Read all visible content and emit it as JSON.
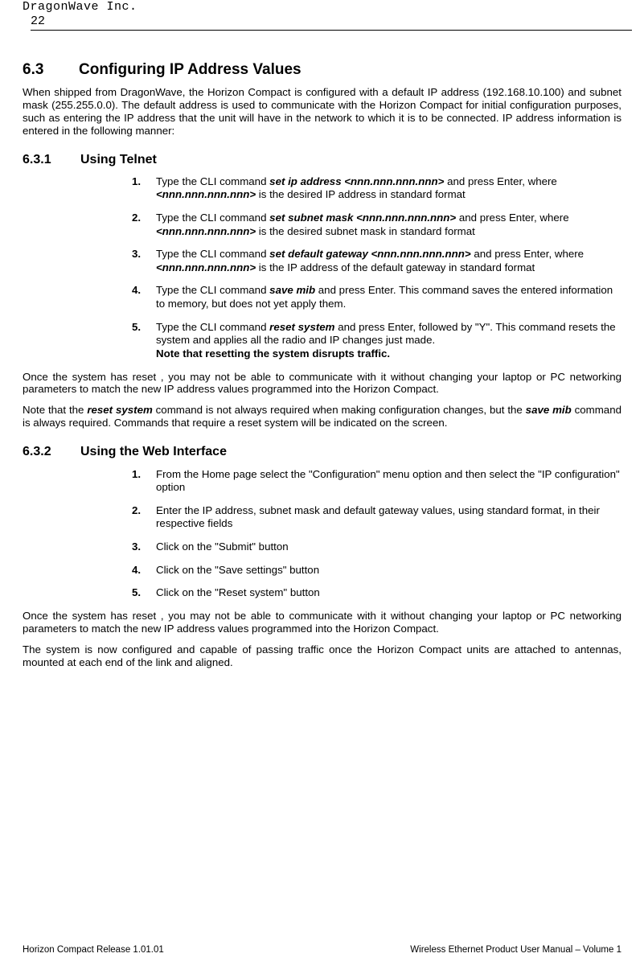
{
  "header": {
    "company": "DragonWave Inc.",
    "page_number": "22"
  },
  "s63": {
    "num": "6.3",
    "title": "Configuring IP Address Values",
    "intro": "When shipped from DragonWave, the Horizon Compact is configured with a default IP address (192.168.10.100) and subnet mask (255.255.0.0). The default address is used to communicate with the Horizon Compact for initial configuration purposes, such as entering the IP address that the unit will have in the network to which it is to be connected. IP address information is entered in the following manner:"
  },
  "s631": {
    "num": "6.3.1",
    "title": "Using Telnet",
    "items": [
      {
        "n": "1.",
        "pre": "Type the CLI command ",
        "cmd": "set ip address <nnn.nnn.nnn.nnn>",
        "mid": " and press Enter, where ",
        "arg": "<nnn.nnn.nnn.nnn>",
        "post": " is the desired IP address in standard format"
      },
      {
        "n": "2.",
        "pre": "Type the CLI command ",
        "cmd": "set subnet mask <nnn.nnn.nnn.nnn>",
        "mid": " and press Enter, where ",
        "arg": "<nnn.nnn.nnn.nnn>",
        "post": " is the desired subnet mask in standard format"
      },
      {
        "n": "3.",
        "pre": "Type the CLI command ",
        "cmd": "set default gateway <nnn.nnn.nnn.nnn>",
        "mid": " and press Enter, where ",
        "arg": "<nnn.nnn.nnn.nnn>",
        "post": " is the IP address of the default gateway in standard format"
      },
      {
        "n": "4.",
        "pre": "Type the CLI command ",
        "cmd": "save mib",
        "mid": " and press Enter. This command saves the entered information to memory, but does not yet apply them.",
        "arg": "",
        "post": ""
      },
      {
        "n": "5.",
        "pre": "Type the CLI command ",
        "cmd": "reset system",
        "mid": " and press Enter, followed by \"Y\". This command resets the system and applies all the radio and IP changes just made.",
        "arg": "",
        "post": "",
        "notebold": "Note that resetting the system disrupts traffic."
      }
    ],
    "after1": "Once the system has reset , you may not be able to communicate with it without changing your laptop or PC networking parameters to match the new IP address values programmed into the Horizon Compact.",
    "after2_pre": "Note that the ",
    "after2_cmd1": "reset system",
    "after2_mid1": " command is not always required when making configuration changes, but the ",
    "after2_cmd2": "save mib",
    "after2_post": " command is always required. Commands that require a reset system will be indicated on the screen."
  },
  "s632": {
    "num": "6.3.2",
    "title": "Using the Web Interface",
    "items": [
      {
        "n": "1.",
        "text": "From the Home page select the \"Configuration\" menu option and then select the \"IP configuration\" option"
      },
      {
        "n": "2.",
        "text": "Enter the IP address, subnet mask and default gateway values, using standard format, in their respective fields"
      },
      {
        "n": "3.",
        "text": "Click on the \"Submit\" button"
      },
      {
        "n": "4.",
        "text": "Click on the \"Save settings\" button"
      },
      {
        "n": "5.",
        "text": "Click on the \"Reset system\" button"
      }
    ],
    "after1": "Once the system has reset , you may not be able to communicate with it without changing your laptop or PC networking parameters to match the new IP address values programmed into the Horizon Compact.",
    "after2": "The system is now configured and capable of passing traffic once the Horizon Compact units are attached to antennas, mounted at each end of the link and aligned."
  },
  "footer": {
    "left": "Horizon Compact Release 1.01.01",
    "right": "Wireless Ethernet Product User Manual – Volume 1"
  }
}
